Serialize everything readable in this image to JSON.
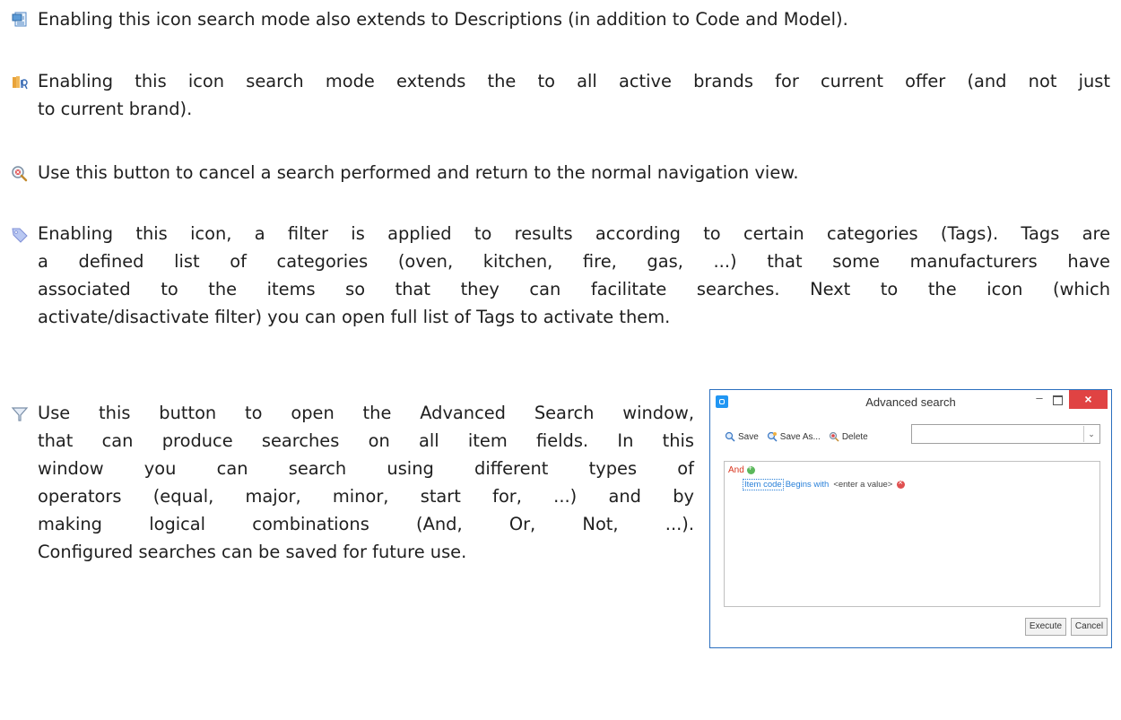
{
  "paragraphs": [
    {
      "icon": "description-search-icon",
      "lines": [
        "Enabling this icon search mode also extends to Descriptions (in addition to Code and Model)."
      ]
    },
    {
      "icon": "all-brands-search-icon",
      "lines": [
        "Enabling this icon search mode extends the to all active brands for current offer (and not just",
        "to current brand)."
      ]
    },
    {
      "icon": "cancel-search-icon",
      "lines": [
        "Use this button to cancel a search performed and return to the normal navigation view."
      ]
    },
    {
      "icon": "tag-filter-icon",
      "lines": [
        "Enabling this icon, a filter is applied to results according to certain categories (Tags). Tags are",
        "a defined list of categories (oven, kitchen, fire, gas, ...) that some manufacturers have",
        "associated to the items so that they can facilitate searches. Next to the icon (which",
        "activate/disactivate filter) you can open full list of Tags to activate them."
      ]
    },
    {
      "icon": "advanced-search-filter-icon",
      "lines": [
        "Use this button to open the Advanced Search window,",
        "that can produce searches on all item fields. In this",
        "window you can search using different types of",
        "operators (equal, major, minor, start for, ...) and by",
        "making logical combinations (And, Or, Not, ...).",
        "Configured searches can be saved for future use."
      ]
    }
  ],
  "advanced_search": {
    "title": "Advanced search",
    "toolbar": {
      "save": "Save",
      "save_as": "Save As...",
      "delete": "Delete"
    },
    "combo_value": "",
    "query": {
      "root_operator": "And",
      "condition": {
        "field": "Item code",
        "operator": "Begins with",
        "value": "<enter a value>"
      }
    },
    "buttons": {
      "execute": "Execute",
      "cancel": "Cancel"
    },
    "close_glyph": "×",
    "minimize_glyph": "–",
    "combo_arrow": "⌄"
  }
}
